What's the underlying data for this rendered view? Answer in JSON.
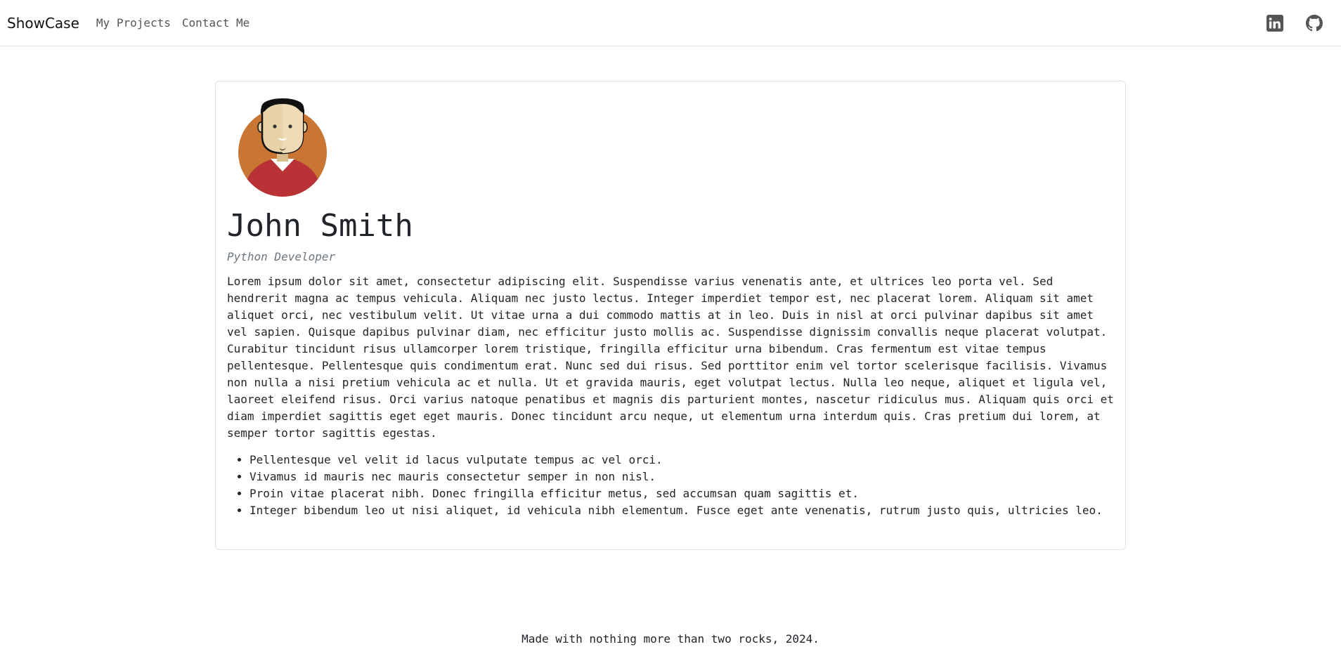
{
  "navbar": {
    "brand": "ShowCase",
    "links": [
      {
        "label": "My Projects"
      },
      {
        "label": "Contact Me"
      }
    ],
    "social": [
      {
        "icon": "linkedin-icon"
      },
      {
        "icon": "github-icon"
      }
    ]
  },
  "profile": {
    "name": "John Smith",
    "role": "Python Developer",
    "bio": "Lorem ipsum dolor sit amet, consectetur adipiscing elit. Suspendisse varius venenatis ante, et ultrices leo porta vel. Sed hendrerit magna ac tempus vehicula. Aliquam nec justo lectus. Integer imperdiet tempor est, nec placerat lorem. Aliquam sit amet aliquet orci, nec vestibulum velit. Ut vitae urna a dui commodo mattis at in leo. Duis in nisl at orci pulvinar dapibus sit amet vel sapien. Quisque dapibus pulvinar diam, nec efficitur justo mollis ac. Suspendisse dignissim convallis neque placerat volutpat. Curabitur tincidunt risus ullamcorper lorem tristique, fringilla efficitur urna bibendum. Cras fermentum est vitae tempus pellentesque. Pellentesque quis condimentum erat. Nunc sed dui risus. Sed porttitor enim vel tortor scelerisque facilisis. Vivamus non nulla a nisi pretium vehicula ac et nulla. Ut et gravida mauris, eget volutpat lectus. Nulla leo neque, aliquet et ligula vel, laoreet eleifend risus. Orci varius natoque penatibus et magnis dis parturient montes, nascetur ridiculus mus. Aliquam quis orci et diam imperdiet sagittis eget eget mauris. Donec tincidunt arcu neque, ut elementum urna interdum quis. Cras pretium dui lorem, at semper tortor sagittis egestas.",
    "bullets": [
      "Pellentesque vel velit id lacus vulputate tempus ac vel orci.",
      "Vivamus id mauris nec mauris consectetur semper in non nisl.",
      "Proin vitae placerat nibh. Donec fringilla efficitur metus, sed accumsan quam sagittis et.",
      "Integer bibendum leo ut nisi aliquet, id vehicula nibh elementum. Fusce eget ante venenatis, rutrum justo quis, ultricies leo."
    ]
  },
  "footer": {
    "text": "Made with nothing more than two rocks, 2024."
  },
  "colors": {
    "avatar_background": "#c97634",
    "shirt": "#b83236",
    "skin": "#e8d3a8",
    "hair": "#111111"
  }
}
